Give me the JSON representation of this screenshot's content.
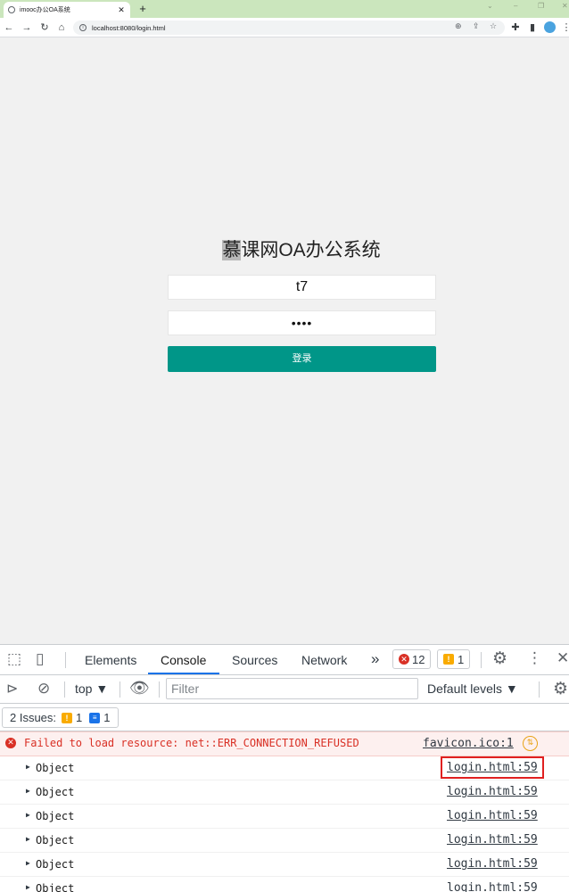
{
  "browser": {
    "tab_title": "imooc办公OA系统",
    "tab_close": "✕",
    "new_tab": "+",
    "url": "localhost:8080/login.html",
    "url_host": "localhost",
    "url_rest": ":8080/login.html"
  },
  "login": {
    "title_selected": "慕",
    "title_rest": "课网OA办公系统",
    "username_value": "t7",
    "password_value": "••••",
    "submit_label": "登录"
  },
  "devtools": {
    "tabs": [
      "Elements",
      "Console",
      "Sources",
      "Network"
    ],
    "active_tab": "Console",
    "more": "»",
    "error_count": "12",
    "warning_count": "1",
    "context": "top",
    "filter_placeholder": "Filter",
    "levels": "Default levels",
    "issues_label": "2 Issues:",
    "issues_warn": "1",
    "issues_info": "1",
    "error_message": "Failed to load resource: net::ERR_CONNECTION_REFUSED",
    "error_source": "favicon.ico:1",
    "log_rows": [
      {
        "text": "Object",
        "source": "login.html:59"
      },
      {
        "text": "Object",
        "source": "login.html:59"
      },
      {
        "text": "Object",
        "source": "login.html:59"
      },
      {
        "text": "Object",
        "source": "login.html:59"
      },
      {
        "text": "Object",
        "source": "login.html:59"
      },
      {
        "text": "Object",
        "source": "login.html:59"
      }
    ]
  },
  "colors": {
    "accent": "#009688",
    "tabbar": "#cbe6bd",
    "error": "#d93025",
    "highlight_box": "#e02020"
  }
}
